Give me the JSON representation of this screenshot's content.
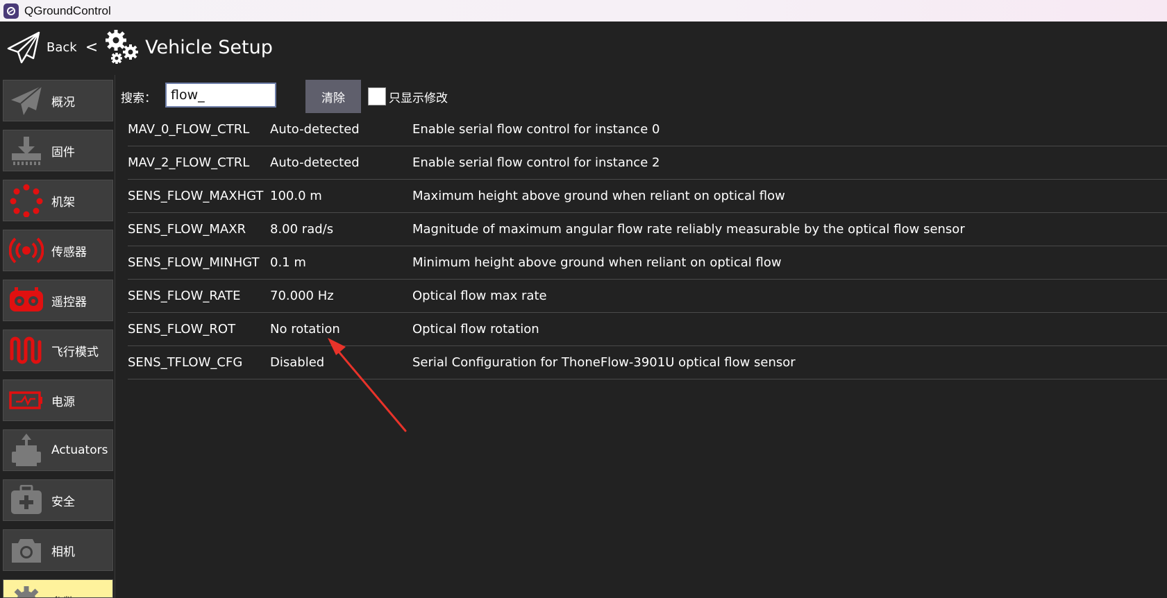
{
  "window": {
    "title": "QGroundControl"
  },
  "header": {
    "back_label": "Back",
    "separator": "<",
    "page_title": "Vehicle Setup"
  },
  "sidebar": {
    "items": [
      {
        "label": "概况",
        "icon": "plane-icon",
        "color": "#7a7a7a"
      },
      {
        "label": "固件",
        "icon": "download-icon",
        "color": "#7a7a7a"
      },
      {
        "label": "机架",
        "icon": "frame-dots-icon",
        "color": "#e01010"
      },
      {
        "label": "传感器",
        "icon": "radio-waves-icon",
        "color": "#e01010"
      },
      {
        "label": "遥控器",
        "icon": "remote-control-icon",
        "color": "#e01010"
      },
      {
        "label": "飞行模式",
        "icon": "wave-icon",
        "color": "#e01010"
      },
      {
        "label": "电源",
        "icon": "battery-icon",
        "color": "#e01010"
      },
      {
        "label": "Actuators",
        "icon": "actuator-icon",
        "color": "#7a7a7a"
      },
      {
        "label": "安全",
        "icon": "first-aid-icon",
        "color": "#7a7a7a"
      },
      {
        "label": "相机",
        "icon": "camera-icon",
        "color": "#7a7a7a"
      },
      {
        "label": "参数",
        "icon": "gear-icon",
        "color": "#7a7a7a",
        "active": true
      }
    ]
  },
  "search": {
    "label": "搜索：",
    "value": "flow_",
    "clear_label": "清除",
    "modified_only_label": "只显示修改",
    "modified_only_checked": false
  },
  "params": [
    {
      "name": "MAV_0_FLOW_CTRL",
      "value": "Auto-detected",
      "desc": "Enable serial flow control for instance 0"
    },
    {
      "name": "MAV_2_FLOW_CTRL",
      "value": "Auto-detected",
      "desc": "Enable serial flow control for instance 2"
    },
    {
      "name": "SENS_FLOW_MAXHGT",
      "value": "100.0 m",
      "desc": "Maximum height above ground when reliant on optical flow"
    },
    {
      "name": "SENS_FLOW_MAXR",
      "value": "8.00 rad/s",
      "desc": "Magnitude of maximum angular flow rate reliably measurable by the optical flow sensor"
    },
    {
      "name": "SENS_FLOW_MINHGT",
      "value": "0.1 m",
      "desc": "Minimum height above ground when reliant on optical flow"
    },
    {
      "name": "SENS_FLOW_RATE",
      "value": "70.000 Hz",
      "desc": "Optical flow max rate"
    },
    {
      "name": "SENS_FLOW_ROT",
      "value": "No rotation",
      "desc": "Optical flow rotation"
    },
    {
      "name": "SENS_TFLOW_CFG",
      "value": "Disabled",
      "desc": "Serial Configuration for ThoneFlow-3901U optical flow sensor"
    }
  ],
  "colors": {
    "background": "#222222",
    "active_item": "#fef29c",
    "warning_red": "#e01010",
    "annotation_arrow": "#e8332a"
  }
}
